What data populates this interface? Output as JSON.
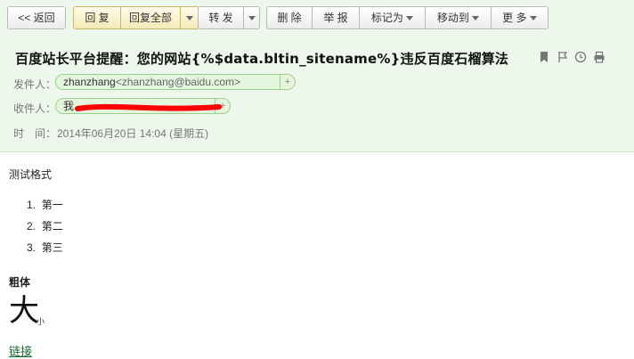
{
  "toolbar": {
    "back": "<< 返回",
    "reply": "回 复",
    "reply_all": "回复全部",
    "forward": "转 发",
    "delete": "删 除",
    "report": "举 报",
    "mark_as": "标记为",
    "move_to": "移动到",
    "more": "更 多"
  },
  "mail": {
    "subject": "百度站长平台提醒：您的网站{%$data.bltin_sitename%}违反百度石榴算法",
    "sender_label": "发件人：",
    "sender_name": "zhanzhang",
    "sender_email": "<zhanzhang@baidu.com>",
    "recipient_label": "收件人：",
    "recipient_name": "我",
    "time_label": "时　间：",
    "time_value": "2014年06月20日 14:04 (星期五)",
    "add_symbol": "+"
  },
  "content": {
    "line1": "测试格式",
    "list": [
      "第一",
      "第二",
      "第三"
    ],
    "bold_text": "粗体",
    "big_text": "大",
    "small_text": "小",
    "link_text": "链接"
  },
  "icons": [
    "bookmark-icon",
    "flag-icon",
    "clock-icon",
    "print-icon"
  ],
  "colors": {
    "header_bg": "#eef7ec",
    "chip_border": "#9ccf8f",
    "link": "#1a6b35",
    "redaction": "#ff0000"
  }
}
